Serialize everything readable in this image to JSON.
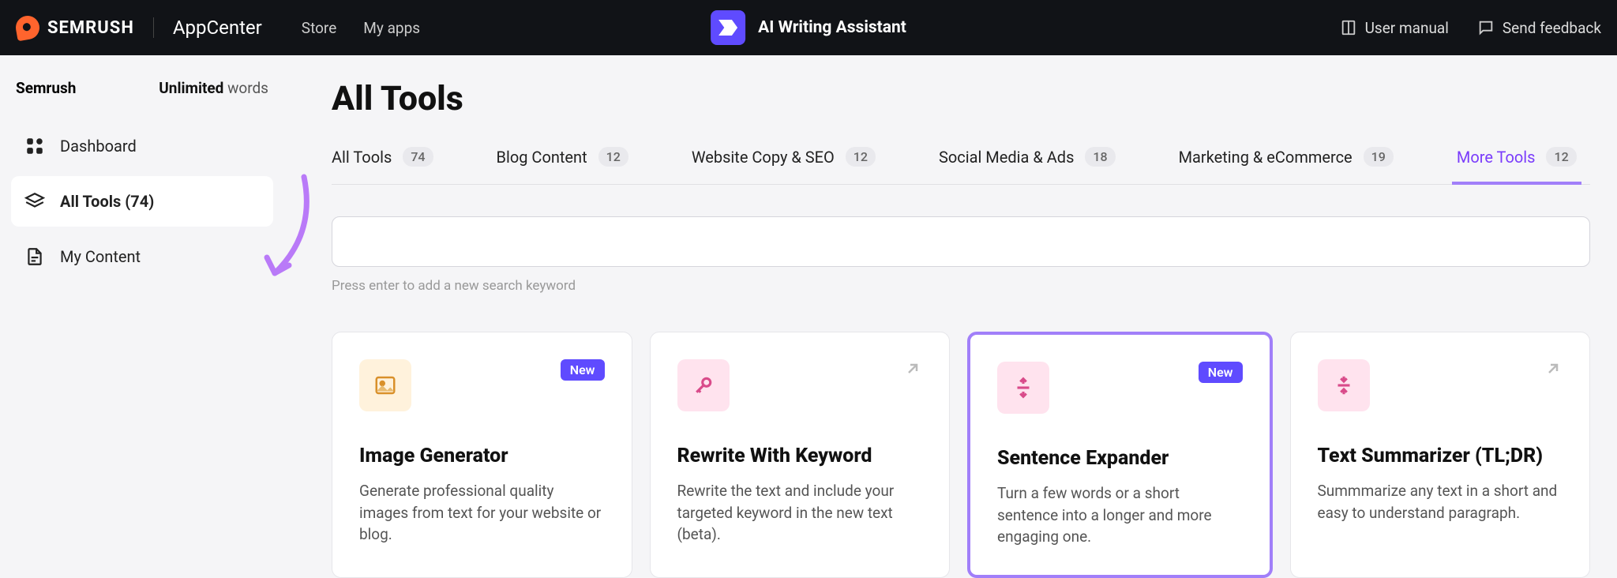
{
  "topbar": {
    "brand": "SEMRUSH",
    "appcenter": "AppCenter",
    "store": "Store",
    "myapps": "My apps",
    "app_name": "AI Writing Assistant",
    "user_manual": "User manual",
    "send_feedback": "Send feedback"
  },
  "sidebar": {
    "brand": "Semrush",
    "unlimited": "Unlimited",
    "words": "words",
    "dashboard": "Dashboard",
    "all_tools": "All Tools (74)",
    "my_content": "My Content"
  },
  "page": {
    "title": "All Tools",
    "search_hint": "Press enter to add a new search keyword"
  },
  "tabs": [
    {
      "label": "All Tools",
      "count": "74"
    },
    {
      "label": "Blog Content",
      "count": "12"
    },
    {
      "label": "Website Copy & SEO",
      "count": "12"
    },
    {
      "label": "Social Media & Ads",
      "count": "18"
    },
    {
      "label": "Marketing & eCommerce",
      "count": "19"
    },
    {
      "label": "More Tools",
      "count": "12"
    }
  ],
  "cards": [
    {
      "title": "Image Generator",
      "desc": "Generate professional quality images from text for your website or blog.",
      "badge": "New",
      "icon": "image"
    },
    {
      "title": "Rewrite With Keyword",
      "desc": "Rewrite the text and include your targeted keyword in the new text (beta).",
      "external": true,
      "icon": "key"
    },
    {
      "title": "Sentence Expander",
      "desc": "Turn a few words or a short sentence into a longer and more engaging one.",
      "badge": "New",
      "icon": "expand",
      "highlight": true
    },
    {
      "title": "Text Summarizer (TL;DR)",
      "desc": "Summmarize any text in a short and easy to understand paragraph.",
      "external": true,
      "icon": "collapse"
    }
  ]
}
